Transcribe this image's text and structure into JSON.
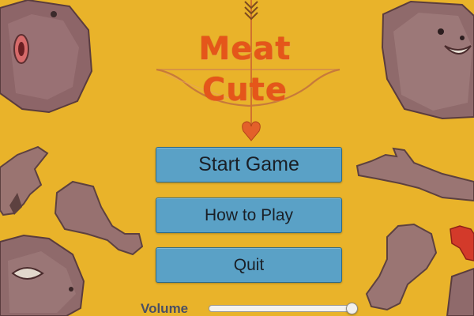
{
  "game": {
    "title": "Meat Cute"
  },
  "menu": {
    "start_label": "Start Game",
    "howto_label": "How to Play",
    "quit_label": "Quit"
  },
  "settings": {
    "volume_label": "Volume",
    "volume_level": 0.98
  },
  "icons": {
    "arrow": "arrow-icon",
    "heart": "heart-icon",
    "bow": "bow-icon"
  },
  "colors": {
    "background": "#e9b32a",
    "title": "#e5561a",
    "button": "#5aa1c6",
    "button_text": "#1a1f26"
  }
}
